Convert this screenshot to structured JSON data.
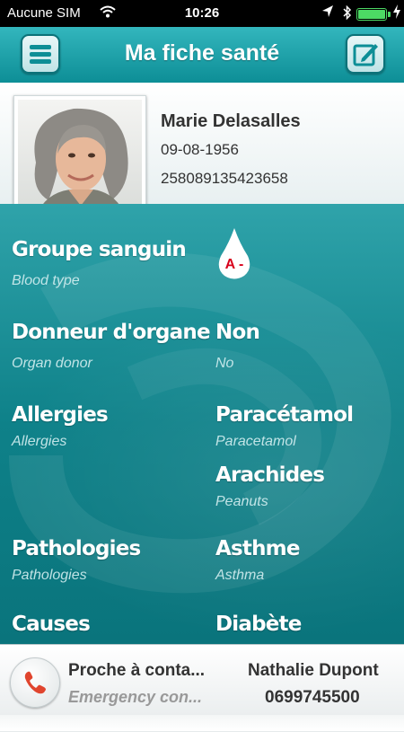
{
  "status_bar": {
    "carrier": "Aucune SIM",
    "time": "10:26",
    "battery_level": 1.0,
    "icons": [
      "wifi-icon",
      "location-arrow-icon",
      "bluetooth-icon",
      "battery-icon",
      "charging-icon"
    ]
  },
  "nav": {
    "title": "Ma fiche santé",
    "left_icon": "menu-icon",
    "right_icon": "edit-icon"
  },
  "profile": {
    "name": "Marie Delasalles",
    "birth_date": "09-08-1956",
    "ssn": "258089135423658"
  },
  "fields": {
    "blood": {
      "label": "Groupe sanguin",
      "sublabel": "Blood type",
      "value": "A -"
    },
    "organ": {
      "label": "Donneur d'organe",
      "sublabel": "Organ donor",
      "value": "Non",
      "value_en": "No"
    },
    "allergies": {
      "label": "Allergies",
      "sublabel": "Allergies",
      "items": [
        {
          "value": "Paracétamol",
          "value_en": "Paracetamol"
        },
        {
          "value": "Arachides",
          "value_en": "Peanuts"
        }
      ]
    },
    "pathologies": {
      "label": "Pathologies",
      "sublabel": "Pathologies",
      "items": [
        {
          "value": "Asthme",
          "value_en": "Asthma"
        }
      ]
    },
    "causes": {
      "label": "Causes",
      "value": "Diabète"
    }
  },
  "footer": {
    "contact_label": "Proche à conta...",
    "contact_sublabel": "Emergency con...",
    "contact_name": "Nathalie Dupont",
    "contact_phone": "0699745500",
    "phone_icon": "phone-icon"
  },
  "colors": {
    "teal_dark": "#0d8e96",
    "teal_light": "#33b6bd",
    "blood_red": "#d8001c"
  }
}
